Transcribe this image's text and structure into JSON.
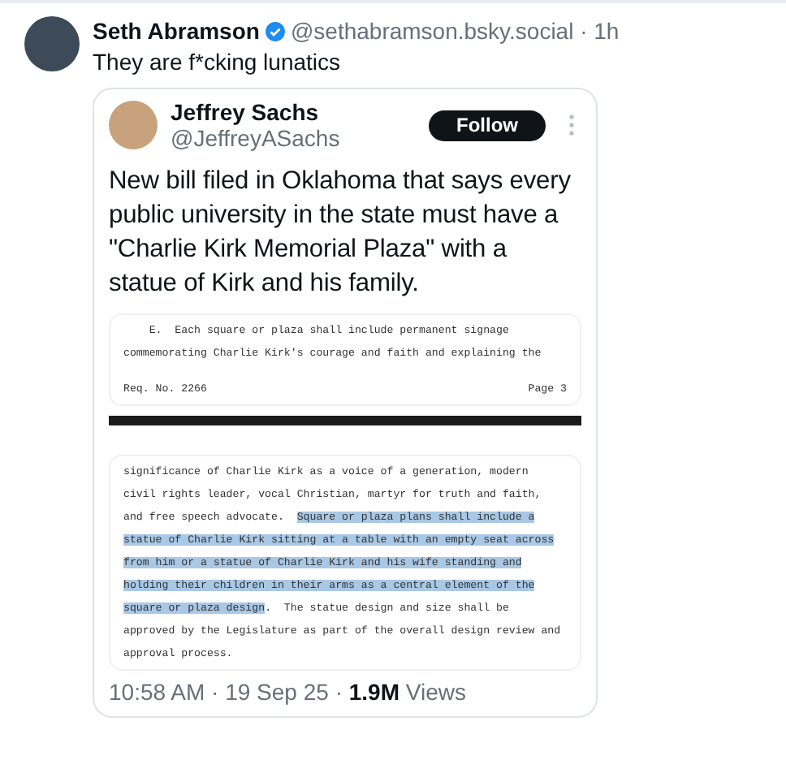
{
  "post": {
    "author": "Seth Abramson",
    "verified": true,
    "handle": "@sethabramson.bsky.social · 1h",
    "text": "They are f*cking lunatics"
  },
  "quote": {
    "author": "Jeffrey Sachs",
    "handle": "@JeffreyASachs",
    "follow_button": "Follow",
    "text": "New bill filed in Oklahoma that says every public university in the state must have a \"Charlie Kirk Memorial Plaza\" with a statue of Kirk and his family.",
    "document": {
      "pages": [
        {
          "lines": [
            {
              "kind": "body",
              "segments": [
                {
                  "text": "    E.  Each square or plaza shall include permanent signage",
                  "highlighted": false
                }
              ]
            },
            {
              "kind": "body",
              "segments": [
                {
                  "text": "commemorating Charlie Kirk's courage and faith and explaining the",
                  "highlighted": false
                }
              ]
            },
            {
              "kind": "footer",
              "segments": [
                {
                  "text": "Req. No. 2266",
                  "highlighted": false
                }
              ],
              "right": "Page 3"
            }
          ]
        },
        {
          "lines": [
            {
              "kind": "body",
              "segments": [
                {
                  "text": "significance of Charlie Kirk as a voice of a generation, modern",
                  "highlighted": false
                }
              ]
            },
            {
              "kind": "body",
              "segments": [
                {
                  "text": "civil rights leader, vocal Christian, martyr for truth and faith,",
                  "highlighted": false
                }
              ]
            },
            {
              "kind": "body",
              "segments": [
                {
                  "text": "and free speech advocate.  ",
                  "highlighted": false
                },
                {
                  "text": "Square or plaza plans shall include a",
                  "highlighted": true
                }
              ]
            },
            {
              "kind": "body",
              "segments": [
                {
                  "text": "statue of Charlie Kirk sitting at a table with an empty seat across",
                  "highlighted": true
                }
              ]
            },
            {
              "kind": "body",
              "segments": [
                {
                  "text": "from him or a statue of Charlie Kirk and his wife standing and",
                  "highlighted": true
                }
              ]
            },
            {
              "kind": "body",
              "segments": [
                {
                  "text": "holding their children in their arms as a central element of the",
                  "highlighted": true
                }
              ]
            },
            {
              "kind": "body",
              "segments": [
                {
                  "text": "square or plaza design",
                  "highlighted": true
                },
                {
                  "text": ".  The statue design and size shall be",
                  "highlighted": false
                }
              ]
            },
            {
              "kind": "body",
              "segments": [
                {
                  "text": "approved by the Legislature as part of the overall design review and",
                  "highlighted": false
                }
              ]
            },
            {
              "kind": "body",
              "segments": [
                {
                  "text": "approval process.",
                  "highlighted": false
                }
              ]
            }
          ]
        }
      ]
    },
    "footer": "10:58 AM · 19 Sep 25 · **1.9M** Views"
  }
}
